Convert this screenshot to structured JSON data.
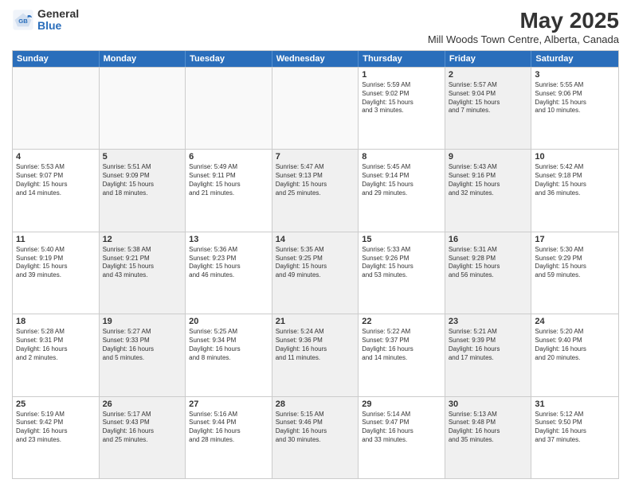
{
  "logo": {
    "general": "General",
    "blue": "Blue"
  },
  "header": {
    "month_year": "May 2025",
    "location": "Mill Woods Town Centre, Alberta, Canada"
  },
  "days_of_week": [
    "Sunday",
    "Monday",
    "Tuesday",
    "Wednesday",
    "Thursday",
    "Friday",
    "Saturday"
  ],
  "weeks": [
    [
      {
        "day": "",
        "info": "",
        "empty": true
      },
      {
        "day": "",
        "info": "",
        "empty": true
      },
      {
        "day": "",
        "info": "",
        "empty": true
      },
      {
        "day": "",
        "info": "",
        "empty": true
      },
      {
        "day": "1",
        "info": "Sunrise: 5:59 AM\nSunset: 9:02 PM\nDaylight: 15 hours\nand 3 minutes.",
        "empty": false,
        "shaded": false
      },
      {
        "day": "2",
        "info": "Sunrise: 5:57 AM\nSunset: 9:04 PM\nDaylight: 15 hours\nand 7 minutes.",
        "empty": false,
        "shaded": true
      },
      {
        "day": "3",
        "info": "Sunrise: 5:55 AM\nSunset: 9:06 PM\nDaylight: 15 hours\nand 10 minutes.",
        "empty": false,
        "shaded": false
      }
    ],
    [
      {
        "day": "4",
        "info": "Sunrise: 5:53 AM\nSunset: 9:07 PM\nDaylight: 15 hours\nand 14 minutes.",
        "empty": false,
        "shaded": false
      },
      {
        "day": "5",
        "info": "Sunrise: 5:51 AM\nSunset: 9:09 PM\nDaylight: 15 hours\nand 18 minutes.",
        "empty": false,
        "shaded": true
      },
      {
        "day": "6",
        "info": "Sunrise: 5:49 AM\nSunset: 9:11 PM\nDaylight: 15 hours\nand 21 minutes.",
        "empty": false,
        "shaded": false
      },
      {
        "day": "7",
        "info": "Sunrise: 5:47 AM\nSunset: 9:13 PM\nDaylight: 15 hours\nand 25 minutes.",
        "empty": false,
        "shaded": true
      },
      {
        "day": "8",
        "info": "Sunrise: 5:45 AM\nSunset: 9:14 PM\nDaylight: 15 hours\nand 29 minutes.",
        "empty": false,
        "shaded": false
      },
      {
        "day": "9",
        "info": "Sunrise: 5:43 AM\nSunset: 9:16 PM\nDaylight: 15 hours\nand 32 minutes.",
        "empty": false,
        "shaded": true
      },
      {
        "day": "10",
        "info": "Sunrise: 5:42 AM\nSunset: 9:18 PM\nDaylight: 15 hours\nand 36 minutes.",
        "empty": false,
        "shaded": false
      }
    ],
    [
      {
        "day": "11",
        "info": "Sunrise: 5:40 AM\nSunset: 9:19 PM\nDaylight: 15 hours\nand 39 minutes.",
        "empty": false,
        "shaded": false
      },
      {
        "day": "12",
        "info": "Sunrise: 5:38 AM\nSunset: 9:21 PM\nDaylight: 15 hours\nand 43 minutes.",
        "empty": false,
        "shaded": true
      },
      {
        "day": "13",
        "info": "Sunrise: 5:36 AM\nSunset: 9:23 PM\nDaylight: 15 hours\nand 46 minutes.",
        "empty": false,
        "shaded": false
      },
      {
        "day": "14",
        "info": "Sunrise: 5:35 AM\nSunset: 9:25 PM\nDaylight: 15 hours\nand 49 minutes.",
        "empty": false,
        "shaded": true
      },
      {
        "day": "15",
        "info": "Sunrise: 5:33 AM\nSunset: 9:26 PM\nDaylight: 15 hours\nand 53 minutes.",
        "empty": false,
        "shaded": false
      },
      {
        "day": "16",
        "info": "Sunrise: 5:31 AM\nSunset: 9:28 PM\nDaylight: 15 hours\nand 56 minutes.",
        "empty": false,
        "shaded": true
      },
      {
        "day": "17",
        "info": "Sunrise: 5:30 AM\nSunset: 9:29 PM\nDaylight: 15 hours\nand 59 minutes.",
        "empty": false,
        "shaded": false
      }
    ],
    [
      {
        "day": "18",
        "info": "Sunrise: 5:28 AM\nSunset: 9:31 PM\nDaylight: 16 hours\nand 2 minutes.",
        "empty": false,
        "shaded": false
      },
      {
        "day": "19",
        "info": "Sunrise: 5:27 AM\nSunset: 9:33 PM\nDaylight: 16 hours\nand 5 minutes.",
        "empty": false,
        "shaded": true
      },
      {
        "day": "20",
        "info": "Sunrise: 5:25 AM\nSunset: 9:34 PM\nDaylight: 16 hours\nand 8 minutes.",
        "empty": false,
        "shaded": false
      },
      {
        "day": "21",
        "info": "Sunrise: 5:24 AM\nSunset: 9:36 PM\nDaylight: 16 hours\nand 11 minutes.",
        "empty": false,
        "shaded": true
      },
      {
        "day": "22",
        "info": "Sunrise: 5:22 AM\nSunset: 9:37 PM\nDaylight: 16 hours\nand 14 minutes.",
        "empty": false,
        "shaded": false
      },
      {
        "day": "23",
        "info": "Sunrise: 5:21 AM\nSunset: 9:39 PM\nDaylight: 16 hours\nand 17 minutes.",
        "empty": false,
        "shaded": true
      },
      {
        "day": "24",
        "info": "Sunrise: 5:20 AM\nSunset: 9:40 PM\nDaylight: 16 hours\nand 20 minutes.",
        "empty": false,
        "shaded": false
      }
    ],
    [
      {
        "day": "25",
        "info": "Sunrise: 5:19 AM\nSunset: 9:42 PM\nDaylight: 16 hours\nand 23 minutes.",
        "empty": false,
        "shaded": false
      },
      {
        "day": "26",
        "info": "Sunrise: 5:17 AM\nSunset: 9:43 PM\nDaylight: 16 hours\nand 25 minutes.",
        "empty": false,
        "shaded": true
      },
      {
        "day": "27",
        "info": "Sunrise: 5:16 AM\nSunset: 9:44 PM\nDaylight: 16 hours\nand 28 minutes.",
        "empty": false,
        "shaded": false
      },
      {
        "day": "28",
        "info": "Sunrise: 5:15 AM\nSunset: 9:46 PM\nDaylight: 16 hours\nand 30 minutes.",
        "empty": false,
        "shaded": true
      },
      {
        "day": "29",
        "info": "Sunrise: 5:14 AM\nSunset: 9:47 PM\nDaylight: 16 hours\nand 33 minutes.",
        "empty": false,
        "shaded": false
      },
      {
        "day": "30",
        "info": "Sunrise: 5:13 AM\nSunset: 9:48 PM\nDaylight: 16 hours\nand 35 minutes.",
        "empty": false,
        "shaded": true
      },
      {
        "day": "31",
        "info": "Sunrise: 5:12 AM\nSunset: 9:50 PM\nDaylight: 16 hours\nand 37 minutes.",
        "empty": false,
        "shaded": false
      }
    ]
  ]
}
